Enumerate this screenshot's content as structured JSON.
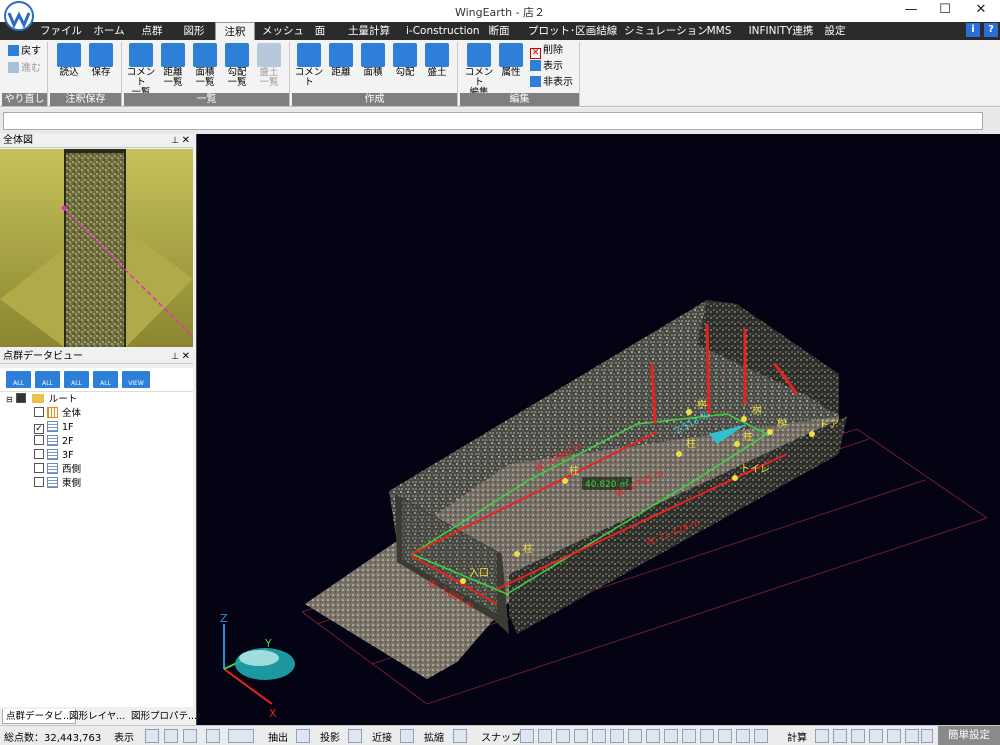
{
  "window": {
    "title": "WingEarth - 店２",
    "minimize": "—",
    "maximize": "☐",
    "close": "✕"
  },
  "menu": {
    "tabs": [
      "ファイル",
      "ホーム",
      "点群",
      "図形",
      "注釈",
      "メッシュ",
      "面",
      "土量計算",
      "i-Construction",
      "断面",
      "プロット･区画結線",
      "シミュレーション",
      "MMS",
      "INFINITY連携",
      "設定"
    ],
    "active_tab": "注釈",
    "info_icon": "i",
    "help_icon": "?"
  },
  "ribbon": {
    "undo_group": {
      "label": "やり直し",
      "back": "戻す",
      "forward": "進む"
    },
    "save_group": {
      "label": "注釈保存",
      "load": "読込",
      "save": "保存"
    },
    "list_group": {
      "label": "一覧",
      "buttons": [
        {
          "line1": "コメント",
          "line2": "一覧"
        },
        {
          "line1": "距離",
          "line2": "一覧"
        },
        {
          "line1": "面積",
          "line2": "一覧"
        },
        {
          "line1": "勾配",
          "line2": "一覧"
        },
        {
          "line1": "盛土",
          "line2": "一覧"
        }
      ]
    },
    "create_group": {
      "label": "作成",
      "buttons": [
        "コメント",
        "距離",
        "面積",
        "勾配",
        "盛土"
      ]
    },
    "edit_group": {
      "label": "編集",
      "comment_edit": {
        "line1": "コメント",
        "line2": "編集"
      },
      "attributes": "属性",
      "delete": "削除",
      "show": "表示",
      "hide": "非表示"
    }
  },
  "panels": {
    "overview": {
      "title": "全体図"
    },
    "pointcloud": {
      "title": "点群データビュー",
      "toolbar": [
        "ALL",
        "ALL",
        "ALL",
        "ALL",
        "VIEW"
      ],
      "tree": {
        "root": "ルート",
        "items": [
          {
            "label": "全体",
            "checked": false
          },
          {
            "label": "1F",
            "checked": true
          },
          {
            "label": "2F",
            "checked": false
          },
          {
            "label": "3F",
            "checked": false
          },
          {
            "label": "西側",
            "checked": false
          },
          {
            "label": "東側",
            "checked": false
          }
        ]
      }
    },
    "bottom_tabs": [
      "点群データビ...",
      "図形レイヤ...",
      "図形プロパテ..."
    ]
  },
  "viewport": {
    "labels": {
      "tamasu1": "桝",
      "hashira1": "柱",
      "tamasu2": "桝",
      "tamasu3": "桝",
      "hashira2": "柱",
      "door": "ドア",
      "toilet": "トイレ",
      "entrance": "入口",
      "hashira3": "柱",
      "hashira4": "柱"
    },
    "measures": {
      "slope": "2.513 %",
      "area": "40.820 ㎡",
      "dist_main": "W: 11.128 m",
      "dist_front": "W: 3.895 m",
      "dist_back": "W: 3.785 m",
      "dist_top": "W: 4.660 m"
    },
    "axes": {
      "z": "Z",
      "y": "Y",
      "x": "X"
    }
  },
  "status": {
    "points_label": "総点数：32,443,763",
    "display": "表示",
    "extract": "抽出",
    "project": "投影",
    "nearest": "近接",
    "expand": "拡縮",
    "snap": "スナップ",
    "calc": "計算",
    "simple_settings": "簡単設定"
  },
  "colors": {
    "accent": "#2e7fd8",
    "menu_bg": "#2b2b2b",
    "viewport_bg": "#030314",
    "measure_red": "#e8231f",
    "area_green": "#3fd23f"
  }
}
